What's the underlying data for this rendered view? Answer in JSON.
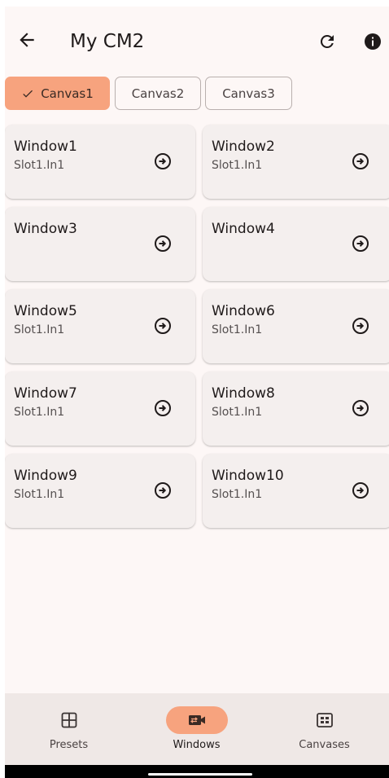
{
  "appbar": {
    "title": "My CM2",
    "back_icon": "arrow-left-icon",
    "refresh_icon": "refresh-icon",
    "info_icon": "info-icon"
  },
  "canvas_tabs": [
    {
      "label": "Canvas1",
      "selected": true
    },
    {
      "label": "Canvas2",
      "selected": false
    },
    {
      "label": "Canvas3",
      "selected": false
    }
  ],
  "windows": [
    {
      "name": "Window1",
      "source": "Slot1.In1"
    },
    {
      "name": "Window2",
      "source": "Slot1.In1"
    },
    {
      "name": "Window3",
      "source": ""
    },
    {
      "name": "Window4",
      "source": ""
    },
    {
      "name": "Window5",
      "source": "Slot1.In1"
    },
    {
      "name": "Window6",
      "source": "Slot1.In1"
    },
    {
      "name": "Window7",
      "source": "Slot1.In1"
    },
    {
      "name": "Window8",
      "source": "Slot1.In1"
    },
    {
      "name": "Window9",
      "source": "Slot1.In1"
    },
    {
      "name": "Window10",
      "source": "Slot1.In1"
    }
  ],
  "bottom_nav": [
    {
      "label": "Presets",
      "icon": "presets-layout-icon",
      "active": false
    },
    {
      "label": "Windows",
      "icon": "windows-switch-icon",
      "active": true
    },
    {
      "label": "Canvases",
      "icon": "canvases-grid-icon",
      "active": false
    }
  ],
  "colors": {
    "accent": "#f7a37e",
    "background": "#fdf7f6",
    "card": "#f4efee",
    "nav_background": "#efe8e6"
  }
}
